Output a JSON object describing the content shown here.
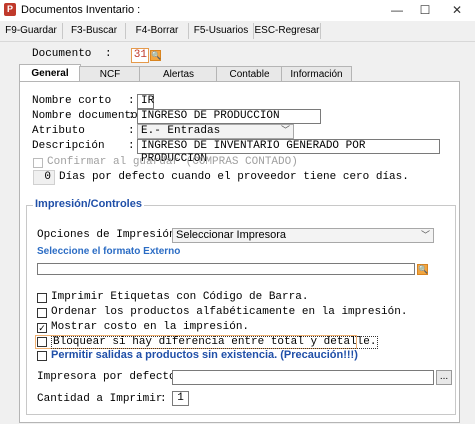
{
  "window": {
    "title": "Documentos Inventario :",
    "min": "—",
    "max": "☐",
    "close": "✕"
  },
  "toolbar": {
    "guardar": "F9-Guardar",
    "buscar": "F3-Buscar",
    "borrar": "F4-Borrar",
    "usuarios": "F5-Usuarios",
    "regresar": "ESC-Regresar"
  },
  "documento": {
    "label": "Documento",
    "colon": ":",
    "value": "31"
  },
  "tabs": [
    {
      "label": "General"
    },
    {
      "label": "NCF"
    },
    {
      "label": "Alertas"
    },
    {
      "label": "Contable"
    },
    {
      "label": "Información"
    }
  ],
  "general": {
    "nombre_corto_label": "Nombre corto",
    "nombre_corto_value": "IR",
    "nombre_documento_label": "Nombre documento",
    "nombre_documento_value": "INGRESO DE PRODUCCION",
    "atributo_label": "Atributo",
    "atributo_value": "E.- Entradas",
    "descripcion_label": "Descripción",
    "descripcion_value": "INGRESO DE INVENTARIO GENERADO POR PRODUCCION",
    "confirmar_label": "Confirmar al guardar (COMPRAS CONTADO)",
    "dias_value": "0",
    "dias_label": "Días por defecto cuando el proveedor tiene cero días."
  },
  "impresion": {
    "section_title": "Impresión/Controles",
    "opciones_label": "Opciones de Impresión:",
    "opciones_value": "Seleccionar Impresora",
    "formato_label": "Seleccione el formato Externo",
    "formato_value": "",
    "chk_etiquetas": "Imprimir Etiquetas con Código de Barra.",
    "chk_ordenar": "Ordenar los productos alfabéticamente en la impresión.",
    "chk_costo": "Mostrar costo en la impresión.",
    "chk_bloquear": "Bloquear si hay diferencia entre total y detalle.",
    "chk_permitir": "Permitir salidas a productos sin existencia. (Precaución!!!)",
    "impresora_label": "Impresora por defecto:",
    "impresora_value": "",
    "impresora_btn": "...",
    "cantidad_label": "Cantidad a Imprimir",
    "cantidad_value": "1"
  }
}
